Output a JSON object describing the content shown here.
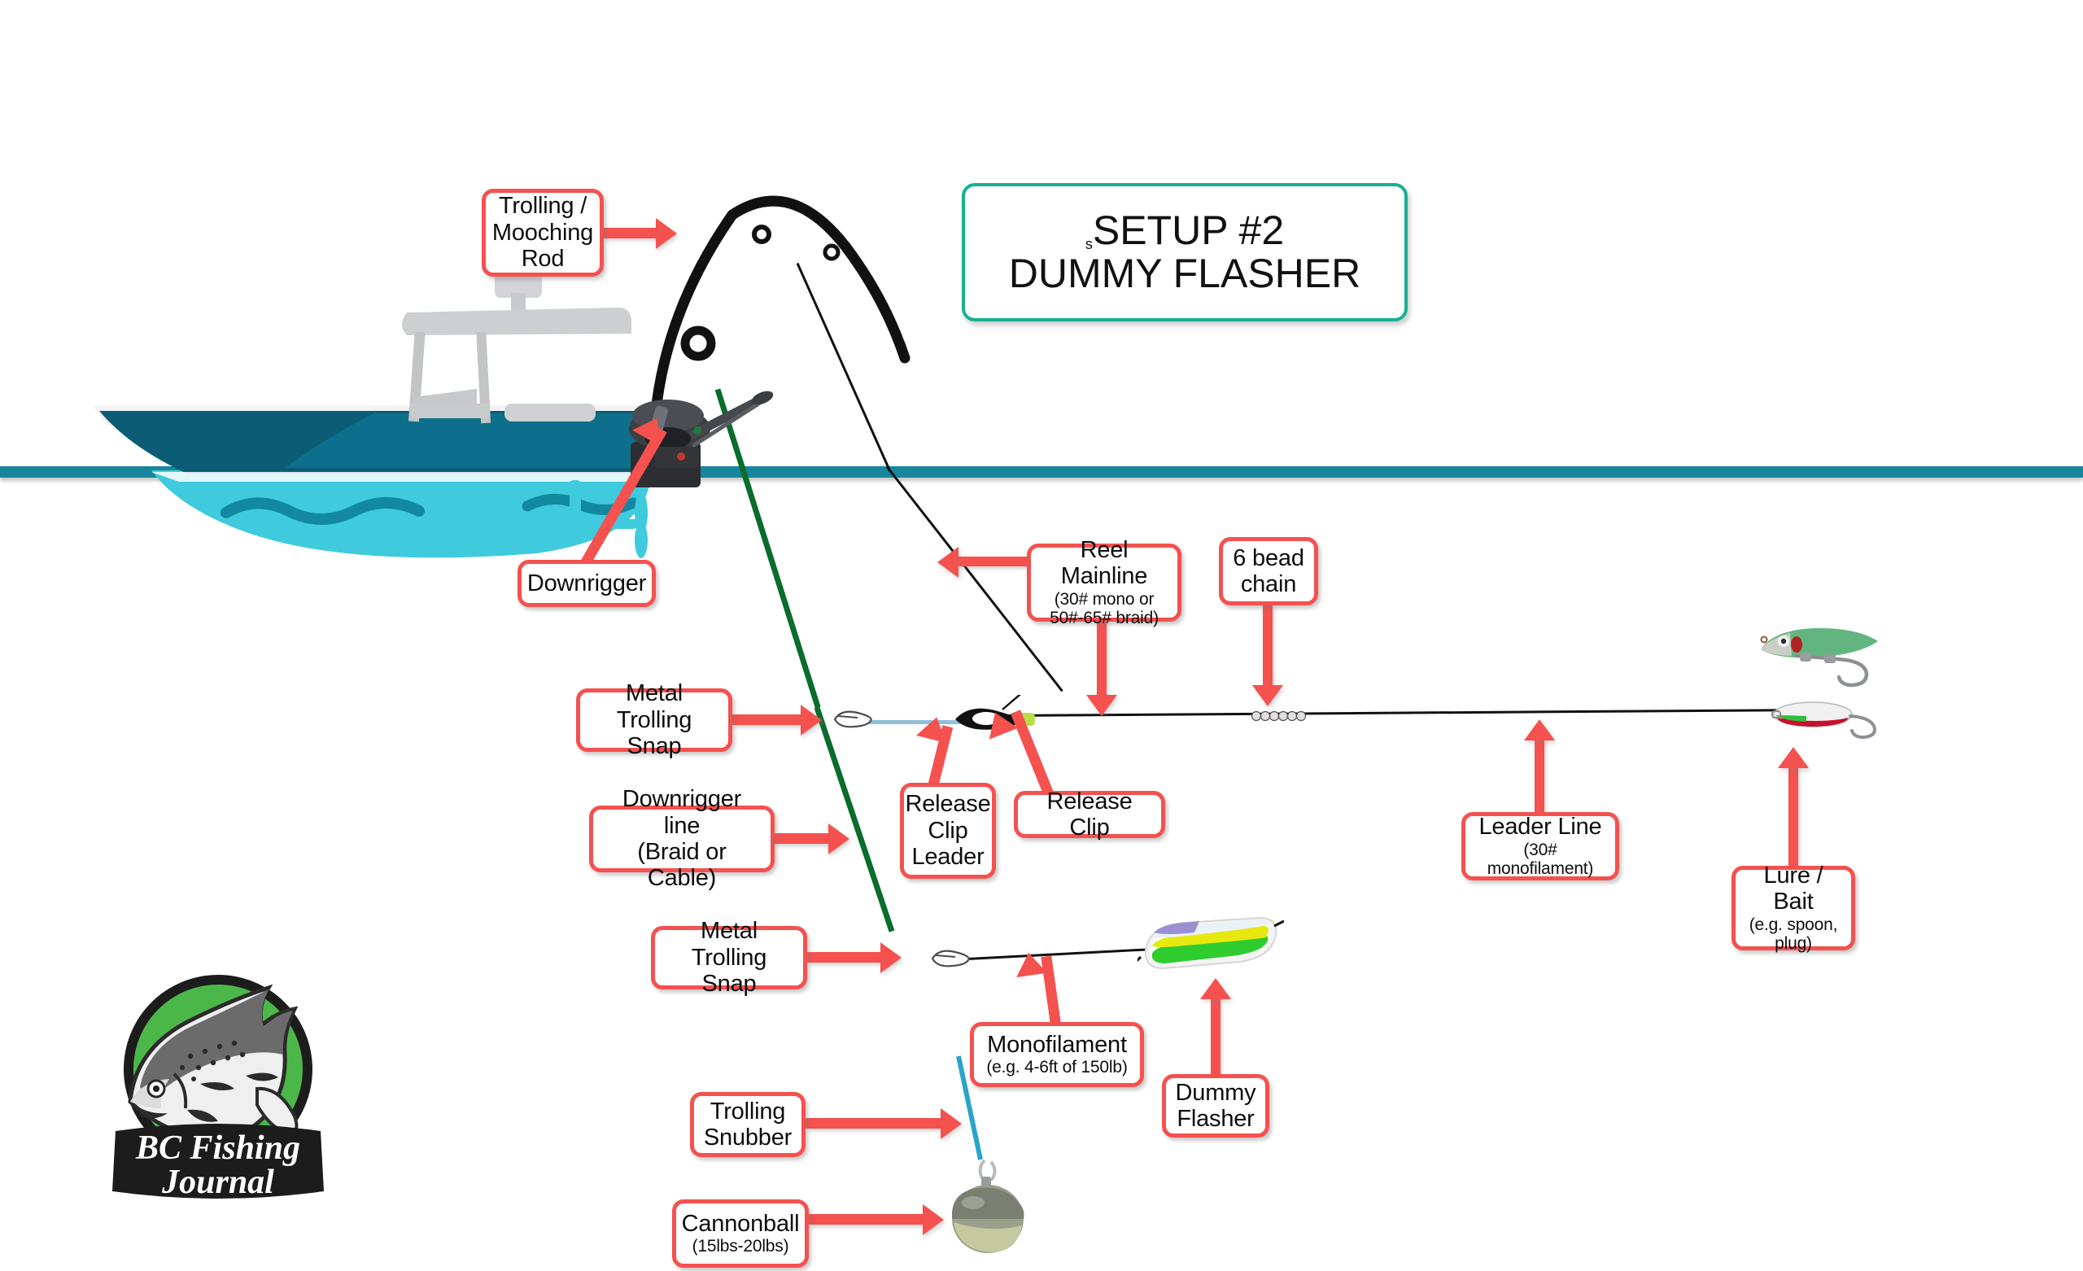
{
  "title": {
    "prefix": "s",
    "line1": "SETUP #2",
    "line2": "DUMMY FLASHER",
    "border_color": "#18b093"
  },
  "brand": {
    "line1": "BC Fishing",
    "line2": "Journal",
    "circle_color": "#4cb749",
    "outline_color": "#1c1c1c"
  },
  "colors": {
    "callout_border": "#f4514f",
    "arrow": "#f4514f",
    "water": "#17859e",
    "hull_dark": "#0b5d75",
    "hull_mid": "#0d6f8b",
    "hull_light_water": "#3fcadd",
    "downrigger_line": "#0a6c2d",
    "mainline": "#111111",
    "release_leader": "#8fc0d8",
    "snubber": "#2aa4c8"
  },
  "labels": {
    "rod": {
      "main": "Trolling /\nMooching\nRod",
      "sub": ""
    },
    "downrigger": {
      "main": "Downrigger",
      "sub": ""
    },
    "reel_mainline": {
      "main": "Reel Mainline",
      "sub": "(30# mono or\n50#-65# braid)"
    },
    "bead_chain": {
      "main": "6 bead\nchain",
      "sub": ""
    },
    "metal_snap_upper": {
      "main": "Metal Trolling\nSnap",
      "sub": ""
    },
    "downrigger_line": {
      "main": "Downrigger line\n(Braid or Cable)",
      "sub": ""
    },
    "release_clip_leader": {
      "main": "Release\nClip\nLeader",
      "sub": ""
    },
    "release_clip": {
      "main": "Release Clip",
      "sub": ""
    },
    "leader_line": {
      "main": "Leader Line",
      "sub": "(30# monofilament)"
    },
    "lure_bait": {
      "main": "Lure / Bait",
      "sub": "(e.g. spoon,\nplug)"
    },
    "metal_snap_lower": {
      "main": "Metal Trolling\nSnap",
      "sub": ""
    },
    "monofilament": {
      "main": "Monofilament",
      "sub": "(e.g. 4-6ft of 150lb)"
    },
    "dummy_flasher": {
      "main": "Dummy\nFlasher",
      "sub": ""
    },
    "trolling_snubber": {
      "main": "Trolling\nSnubber",
      "sub": ""
    },
    "cannonball": {
      "main": "Cannonball",
      "sub": "(15lbs-20lbs)"
    }
  },
  "components": {
    "boat": "fishing-boat",
    "rod": "trolling-rod",
    "downrigger_unit": "downrigger-winch",
    "cannonball": "downrigger-weight-ball",
    "dummy_flasher": "flasher-green-yellow",
    "lure_plug": "green-plug-lure",
    "lure_spoon": "white-green-red-spoon",
    "bead_chain": "six-bead-chain",
    "release_clip": "black-release-clip",
    "snap_upper": "metal-trolling-snap",
    "snap_lower": "metal-trolling-snap"
  }
}
